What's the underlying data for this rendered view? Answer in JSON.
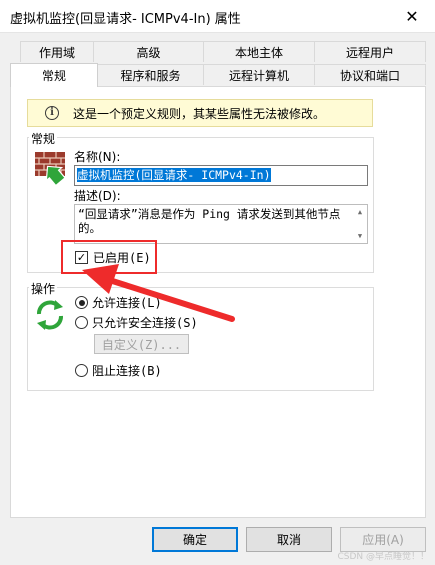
{
  "window": {
    "title": "虚拟机监控(回显请求- ICMPv4-In) 属性",
    "close_glyph": "✕"
  },
  "tabs": {
    "row1": [
      "作用域",
      "高级",
      "本地主体",
      "远程用户"
    ],
    "row2": [
      "常规",
      "程序和服务",
      "远程计算机",
      "协议和端口"
    ]
  },
  "info_bar": {
    "text": "这是一个预定义规则，其某些属性无法被修改。"
  },
  "general_group": {
    "title": "常规",
    "name_label": "名称(N):",
    "name_value": "虚拟机监控(回显请求- ICMPv4-In)",
    "desc_label": "描述(D):",
    "desc_value": "“回显请求”消息是作为 Ping 请求发送到其他节点的。",
    "enabled_label": "已启用(E)",
    "enabled_checked": true,
    "icon": "firewall-rule-icon"
  },
  "action_group": {
    "title": "操作",
    "icon": "refresh-arrows-icon",
    "options": {
      "allow": "允许连接(L)",
      "allow_secure": "只允许安全连接(S)",
      "block": "阻止连接(B)"
    },
    "selected": "allow",
    "customize_label": "自定义(Z)..."
  },
  "footer": {
    "ok": "确定",
    "cancel": "取消",
    "apply": "应用(A)"
  },
  "watermark": "CSDN @早点睡觉！！",
  "colors": {
    "highlight": "#ee2b2b",
    "selection": "#0078d7",
    "info_bg": "#fffbd5",
    "icon_green": "#2fa53a"
  }
}
